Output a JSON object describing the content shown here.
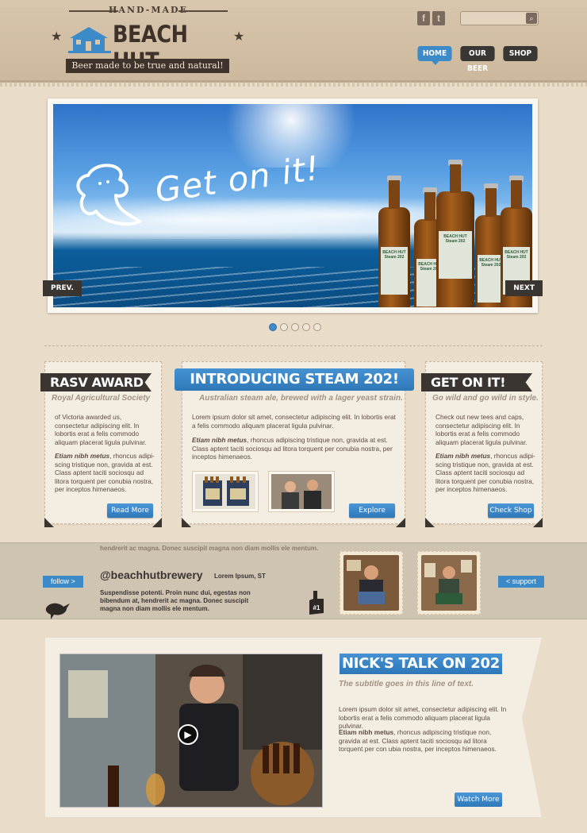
{
  "header": {
    "handmade": "HAND-MADE",
    "brand": "BEACH HUT",
    "tagline": "Beer made to be true and natural!",
    "social": [
      {
        "icon": "facebook-icon",
        "glyph": "f"
      },
      {
        "icon": "twitter-icon",
        "glyph": "t"
      }
    ],
    "search_placeholder": "",
    "nav": [
      {
        "label": "HOME",
        "active": true
      },
      {
        "label": "OUR BEER",
        "active": false
      },
      {
        "label": "SHOP",
        "active": false
      }
    ]
  },
  "slider": {
    "headline": "Get on it!",
    "prev": "PREV.",
    "next": "NEXT",
    "bottle_label": "BEACH HUT Steam 202",
    "dots": 5,
    "active_dot": 0
  },
  "cards": {
    "left": {
      "title": "RASV AWARD",
      "subtitle": "Royal Agricultural Society",
      "body": "of Victoria awarded us, consectetur adipiscing elit. In lobortis erat a felis commodo aliquam placerat ligula pulvinar.",
      "emph": "Etiam nibh metus",
      "body2": ", rhoncus adipi-scing tristique non, gravida at est. Class aptent taciti sociosqu ad litora torquent per conubia nostra, per inceptos himenaeos.",
      "button": "Read More"
    },
    "center": {
      "title": "INTRODUCING STEAM 202!",
      "subtitle": "Australian steam ale, brewed with a lager yeast strain.",
      "body": "Lorem ipsum dolor sit amet, consectetur adipiscing elit. In lobortis erat a felis commodo aliquam placerat ligula pulvinar.",
      "emph": "Etiam nibh metus",
      "body2": ", rhoncus adipiscing tristique non, gravida at est. Class aptent taciti sociosqu ad litora torquent per conubia nostra, per inceptos himenaeos.",
      "button": "Explore"
    },
    "right": {
      "title": "GET ON IT!",
      "subtitle": "Go wild and go wild in style.",
      "body": "Check out new tees and caps, consectetur adipiscing elit. In lobortis erat a felis commodo aliquam placerat ligula pulvinar.",
      "emph": "Etiam nibh metus",
      "body2": ", rhoncus adipi-scing tristique non, gravida at est. Class aptent taciti sociosqu ad litora torquent per conubia nostra, per inceptos himenaeos.",
      "button": "Check Shop"
    }
  },
  "twitter": {
    "follow": "follow  >",
    "support": "<  support",
    "handle": "@beachhutbrewery",
    "meta": "Lorem Ipsum,  ST",
    "faded": "hendrerit ac magna. Donec suscipit magna non diam mollis ele mentum.",
    "tweet": "Suspendisse potenti. Proin nunc dui, egestas non bibendum at, hendrerit ac magna. Donec suscipit magna non diam mollis ele mentum.",
    "foam_finger": "#1"
  },
  "video": {
    "title": "NICK'S TALK ON 202",
    "subtitle": "The subtitle goes in this line of text.",
    "body": "Lorem ipsum dolor sit amet, consectetur adipiscing elit. In lobortis erat a felis commodo aliquam placerat ligula pulvinar.",
    "emph": "Etiam nibh metus",
    "body2": ", rhoncus adipiscing tristique non, gravida at est. Class aptent taciti sociosqu ad litora torquent per con ubia nostra, per inceptos himenaeos.",
    "button": "Watch More"
  },
  "colors": {
    "accent": "#3d8ac8",
    "dark": "#3b3532",
    "paper": "#e9dcc8"
  }
}
